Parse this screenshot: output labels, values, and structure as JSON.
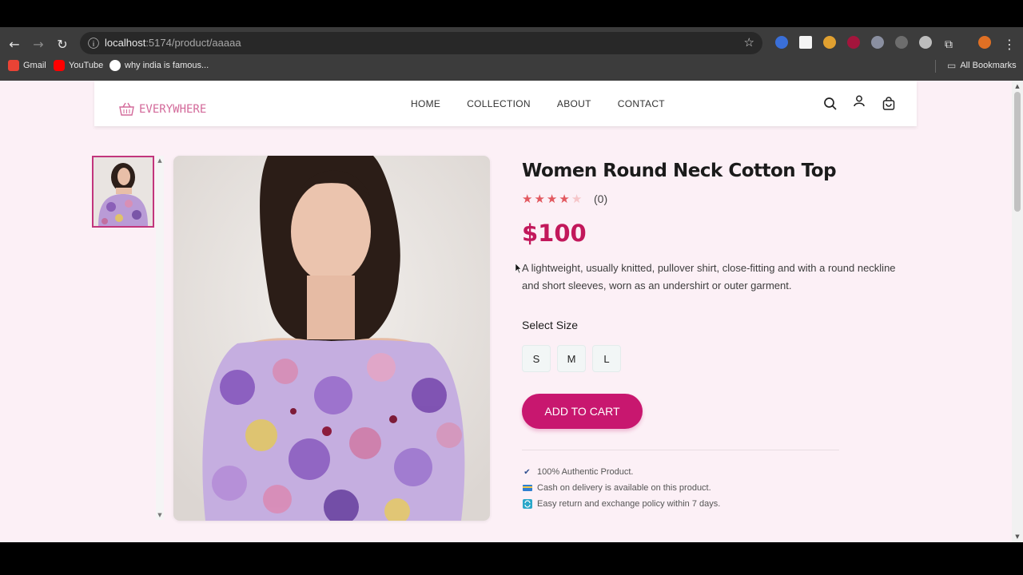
{
  "browser": {
    "url_host": "localhost",
    "url_rest": ":5174/product/aaaaa",
    "bookmarks": [
      {
        "label": "Gmail"
      },
      {
        "label": "YouTube"
      },
      {
        "label": "why india is famous..."
      }
    ],
    "all_bookmarks_label": "All Bookmarks"
  },
  "header": {
    "logo_text": "EVERYWHERE",
    "menu": [
      {
        "label": "HOME"
      },
      {
        "label": "COLLECTION"
      },
      {
        "label": "ABOUT"
      },
      {
        "label": "CONTACT"
      }
    ]
  },
  "product": {
    "title": "Women Round Neck Cotton Top",
    "rating": 4,
    "rating_max": 5,
    "review_count": "(0)",
    "price": "$100",
    "description": "A lightweight, usually knitted, pullover shirt, close-fitting and with a round neckline and short sleeves, worn as an undershirt or outer garment.",
    "select_size_label": "Select Size",
    "sizes": [
      "S",
      "M",
      "L"
    ],
    "add_to_cart_label": "ADD TO CART",
    "features": [
      {
        "text": "100% Authentic Product.",
        "icon": "check-icon"
      },
      {
        "text": "Cash on delivery is available on this product.",
        "icon": "card-icon"
      },
      {
        "text": "Easy return and exchange policy within 7 days.",
        "icon": "return-icon"
      }
    ]
  },
  "colors": {
    "accent": "#c8176f",
    "price": "#c2185b",
    "page_bg": "#fcf0f6",
    "star": "#e2585f"
  }
}
